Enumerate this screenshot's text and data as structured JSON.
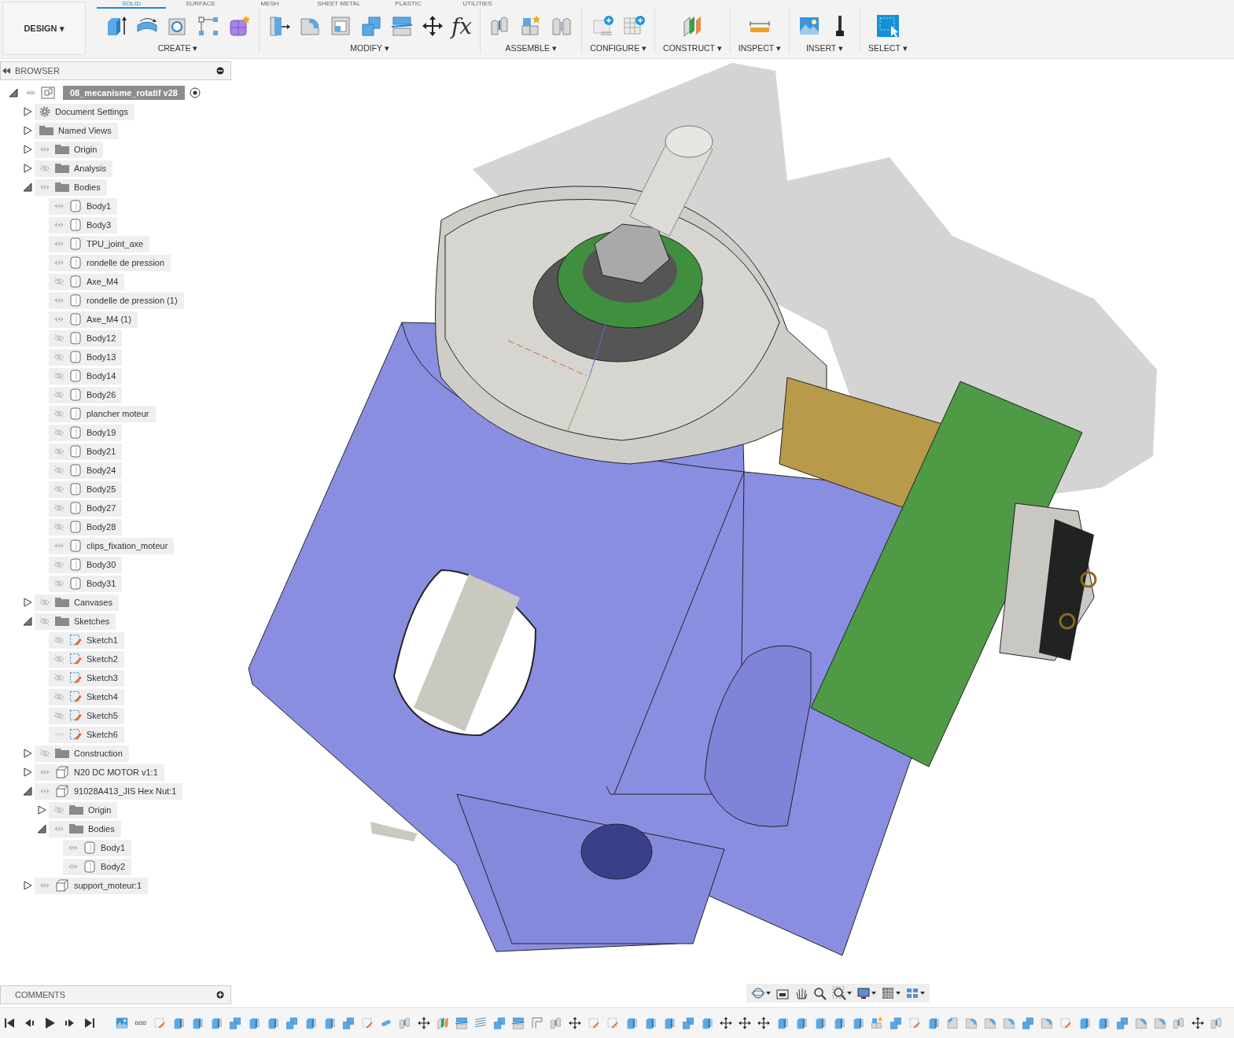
{
  "workspace_button": {
    "label": "DESIGN",
    "caret": "▾"
  },
  "tabs": [
    {
      "label": "SOLID",
      "selected": true
    },
    {
      "label": "SURFACE",
      "selected": false
    },
    {
      "label": "MESH",
      "selected": false
    },
    {
      "label": "SHEET METAL",
      "selected": false
    },
    {
      "label": "PLASTIC",
      "selected": false
    },
    {
      "label": "UTILITIES",
      "selected": false
    }
  ],
  "toolbar_groups": [
    {
      "label": "CREATE ▾"
    },
    {
      "label": "MODIFY ▾",
      "symbol": "fx"
    },
    {
      "label": "ASSEMBLE ▾"
    },
    {
      "label": "CONFIGURE ▾"
    },
    {
      "label": "CONSTRUCT ▾"
    },
    {
      "label": "INSPECT ▾"
    },
    {
      "label": "INSERT ▾"
    },
    {
      "label": "SELECT ▾"
    }
  ],
  "browser": {
    "title": "BROWSER",
    "tree": {
      "label": "08_mecanisme_rotatif v28",
      "kind": "document",
      "visible": true,
      "expanded": true,
      "children": [
        {
          "label": "Document Settings",
          "kind": "settings",
          "expanded": false
        },
        {
          "label": "Named Views",
          "kind": "folder",
          "expanded": false
        },
        {
          "label": "Origin",
          "kind": "folder",
          "visible": true,
          "expanded": false
        },
        {
          "label": "Analysis",
          "kind": "folder",
          "visible": false,
          "expanded": false
        },
        {
          "label": "Bodies",
          "kind": "folder",
          "visible": true,
          "expanded": true,
          "children": [
            {
              "label": "Body1",
              "kind": "body",
              "visible": true
            },
            {
              "label": "Body3",
              "kind": "body",
              "visible": true
            },
            {
              "label": "TPU_joint_axe",
              "kind": "body",
              "visible": true
            },
            {
              "label": "rondelle de pression",
              "kind": "body",
              "visible": true
            },
            {
              "label": "Axe_M4",
              "kind": "body",
              "visible": false
            },
            {
              "label": "rondelle de pression (1)",
              "kind": "body",
              "visible": true
            },
            {
              "label": "Axe_M4 (1)",
              "kind": "body",
              "visible": true
            },
            {
              "label": "Body12",
              "kind": "body",
              "visible": false
            },
            {
              "label": "Body13",
              "kind": "body",
              "visible": false
            },
            {
              "label": "Body14",
              "kind": "body",
              "visible": false
            },
            {
              "label": "Body26",
              "kind": "body",
              "visible": false
            },
            {
              "label": "plancher moteur",
              "kind": "body",
              "visible": false
            },
            {
              "label": "Body19",
              "kind": "body",
              "visible": false
            },
            {
              "label": "Body21",
              "kind": "body",
              "visible": false
            },
            {
              "label": "Body24",
              "kind": "body",
              "visible": false
            },
            {
              "label": "Body25",
              "kind": "body",
              "visible": false
            },
            {
              "label": "Body27",
              "kind": "body",
              "visible": false
            },
            {
              "label": "Body28",
              "kind": "body",
              "visible": false
            },
            {
              "label": "clips_fixation_moteur",
              "kind": "body",
              "visible": true
            },
            {
              "label": "Body30",
              "kind": "body",
              "visible": false
            },
            {
              "label": "Body31",
              "kind": "body",
              "visible": false
            }
          ]
        },
        {
          "label": "Canvases",
          "kind": "folder",
          "visible": false,
          "expanded": false
        },
        {
          "label": "Sketches",
          "kind": "folder",
          "visible": false,
          "expanded": true,
          "children": [
            {
              "label": "Sketch1",
              "kind": "sketch",
              "visible": false
            },
            {
              "label": "Sketch2",
              "kind": "sketch",
              "visible": false
            },
            {
              "label": "Sketch3",
              "kind": "sketch",
              "visible": false
            },
            {
              "label": "Sketch4",
              "kind": "sketch",
              "visible": false
            },
            {
              "label": "Sketch5",
              "kind": "sketch",
              "visible": false
            },
            {
              "label": "Sketch6",
              "kind": "sketch",
              "visible": true,
              "disabled": true
            }
          ]
        },
        {
          "label": "Construction",
          "kind": "folder",
          "visible": false,
          "expanded": false
        },
        {
          "label": "N20 DC MOTOR v1:1",
          "kind": "component",
          "visible": true,
          "expanded": false
        },
        {
          "label": "91028A413_JIS Hex Nut:1",
          "kind": "component",
          "visible": true,
          "expanded": true,
          "children": [
            {
              "label": "Origin",
              "kind": "folder",
              "visible": false,
              "expanded": false
            },
            {
              "label": "Bodies",
              "kind": "folder",
              "visible": true,
              "expanded": true,
              "children": [
                {
                  "label": "Body1",
                  "kind": "body",
                  "visible": true
                },
                {
                  "label": "Body2",
                  "kind": "body",
                  "visible": true
                }
              ]
            }
          ]
        },
        {
          "label": "support_moteur:1",
          "kind": "component",
          "visible": true,
          "expanded": false
        }
      ]
    }
  },
  "comments": {
    "title": "COMMENTS"
  }
}
